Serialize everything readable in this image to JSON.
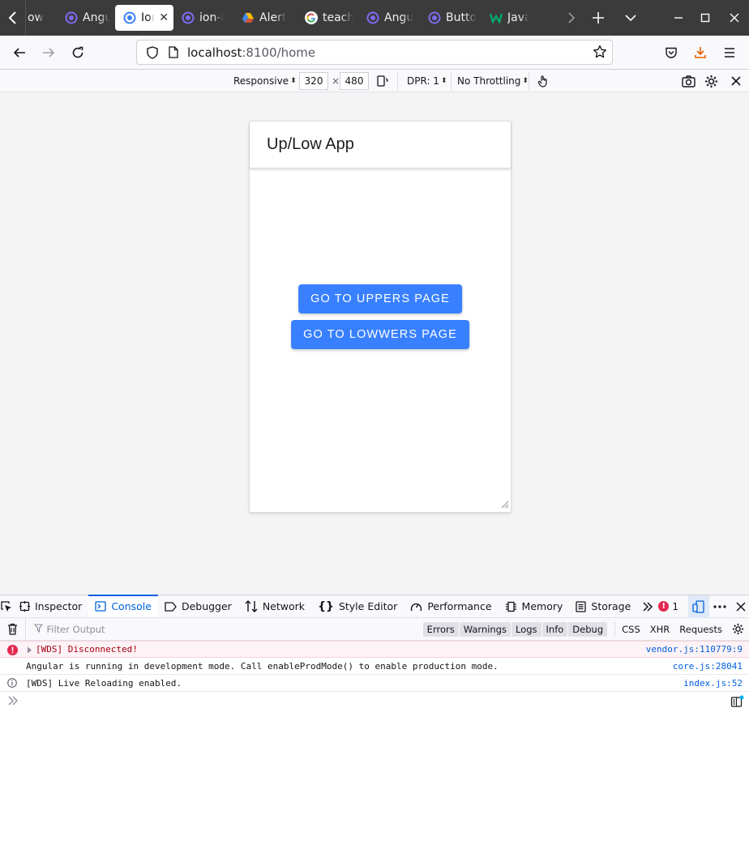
{
  "browser": {
    "tabs": [
      {
        "title": "ow",
        "favicon": "partial-tab"
      },
      {
        "title": "Angu",
        "favicon": "ionic-icon"
      },
      {
        "title": "Ion",
        "favicon": "ionic-icon",
        "active": true
      },
      {
        "title": "ion-i",
        "favicon": "ionic-icon"
      },
      {
        "title": "Alert",
        "favicon": "google-drive-icon"
      },
      {
        "title": "teach",
        "favicon": "google-icon"
      },
      {
        "title": "Angu",
        "favicon": "ionic-icon"
      },
      {
        "title": "Butto",
        "favicon": "ionic-icon"
      },
      {
        "title": "Javat",
        "favicon": "w3schools-icon"
      }
    ],
    "url_host": "localhost",
    "url_path": ":8100/home"
  },
  "rdm": {
    "device": "Responsive",
    "width": "320",
    "times": "×",
    "height": "480",
    "dpr": "DPR: 1",
    "throttling": "No Throttling"
  },
  "app": {
    "title": "Up/Low App",
    "btn_uppers": "GO TO UPPERS PAGE",
    "btn_lowers": "GO TO LOWWERS PAGE"
  },
  "devtools": {
    "tabs": [
      "Inspector",
      "Console",
      "Debugger",
      "Network",
      "Style Editor",
      "Performance",
      "Memory",
      "Storage"
    ],
    "error_count": "1",
    "filter_placeholder": "Filter Output",
    "levels": [
      "Errors",
      "Warnings",
      "Logs",
      "Info",
      "Debug"
    ],
    "extras": [
      "CSS",
      "XHR",
      "Requests"
    ]
  },
  "console": {
    "messages": [
      {
        "level": "error",
        "text": "[WDS] Disconnected!",
        "source": "vendor.js:110779:9"
      },
      {
        "level": "log",
        "text": "Angular is running in development mode. Call enableProdMode() to enable production mode.",
        "source": "core.js:28041"
      },
      {
        "level": "info",
        "text": "[WDS] Live Reloading enabled.",
        "source": "index.js:52"
      }
    ]
  },
  "colors": {
    "ionic_primary": "#3880ff",
    "devtools_accent": "#0061e0",
    "error_red": "#e22850",
    "tabstrip_bg": "#3b3b3b"
  }
}
